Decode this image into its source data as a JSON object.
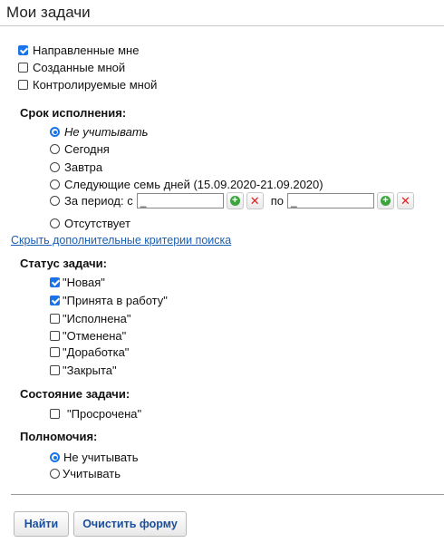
{
  "page": {
    "title": "Мои задачи"
  },
  "assignment_filters": [
    {
      "label": "Направленные мне",
      "checked": true
    },
    {
      "label": "Созданные мной",
      "checked": false
    },
    {
      "label": "Контролируемые мной",
      "checked": false
    }
  ],
  "deadline": {
    "heading": "Срок исполнения:",
    "options": [
      {
        "label": "Не учитывать",
        "selected": true
      },
      {
        "label": "Сегодня",
        "selected": false
      },
      {
        "label": "Завтра",
        "selected": false
      },
      {
        "label": "Следующие семь дней (15.09.2020-21.09.2020)",
        "selected": false
      },
      {
        "label": "За период: с",
        "selected": false
      },
      {
        "label": "Отсутствует",
        "selected": false
      }
    ],
    "period_from_value": "_",
    "period_to_label": "по",
    "period_to_value": "_"
  },
  "hide_criteria_link": "Скрыть дополнительные критерии поиска",
  "task_status": {
    "heading": "Статус задачи:",
    "options": [
      {
        "label": "\"Новая\"",
        "checked": true
      },
      {
        "label": "\"Принята в работу\"",
        "checked": true
      },
      {
        "label": "\"Исполнена\"",
        "checked": false
      },
      {
        "label": "\"Отменена\"",
        "checked": false
      },
      {
        "label": "\"Доработка\"",
        "checked": false
      },
      {
        "label": "\"Закрыта\"",
        "checked": false
      }
    ]
  },
  "task_state": {
    "heading": "Состояние задачи:",
    "options": [
      {
        "label": "\"Просрочена\"",
        "checked": false
      }
    ]
  },
  "authority": {
    "heading": "Полномочия:",
    "options": [
      {
        "label": "Не учитывать",
        "selected": true
      },
      {
        "label": "Учитывать",
        "selected": false
      }
    ]
  },
  "buttons": {
    "find": "Найти",
    "clear": "Очистить форму"
  },
  "colors": {
    "accent": "#1a73e8",
    "link": "#1a5fb4",
    "add": "#3ea33e",
    "remove": "#e02020"
  }
}
